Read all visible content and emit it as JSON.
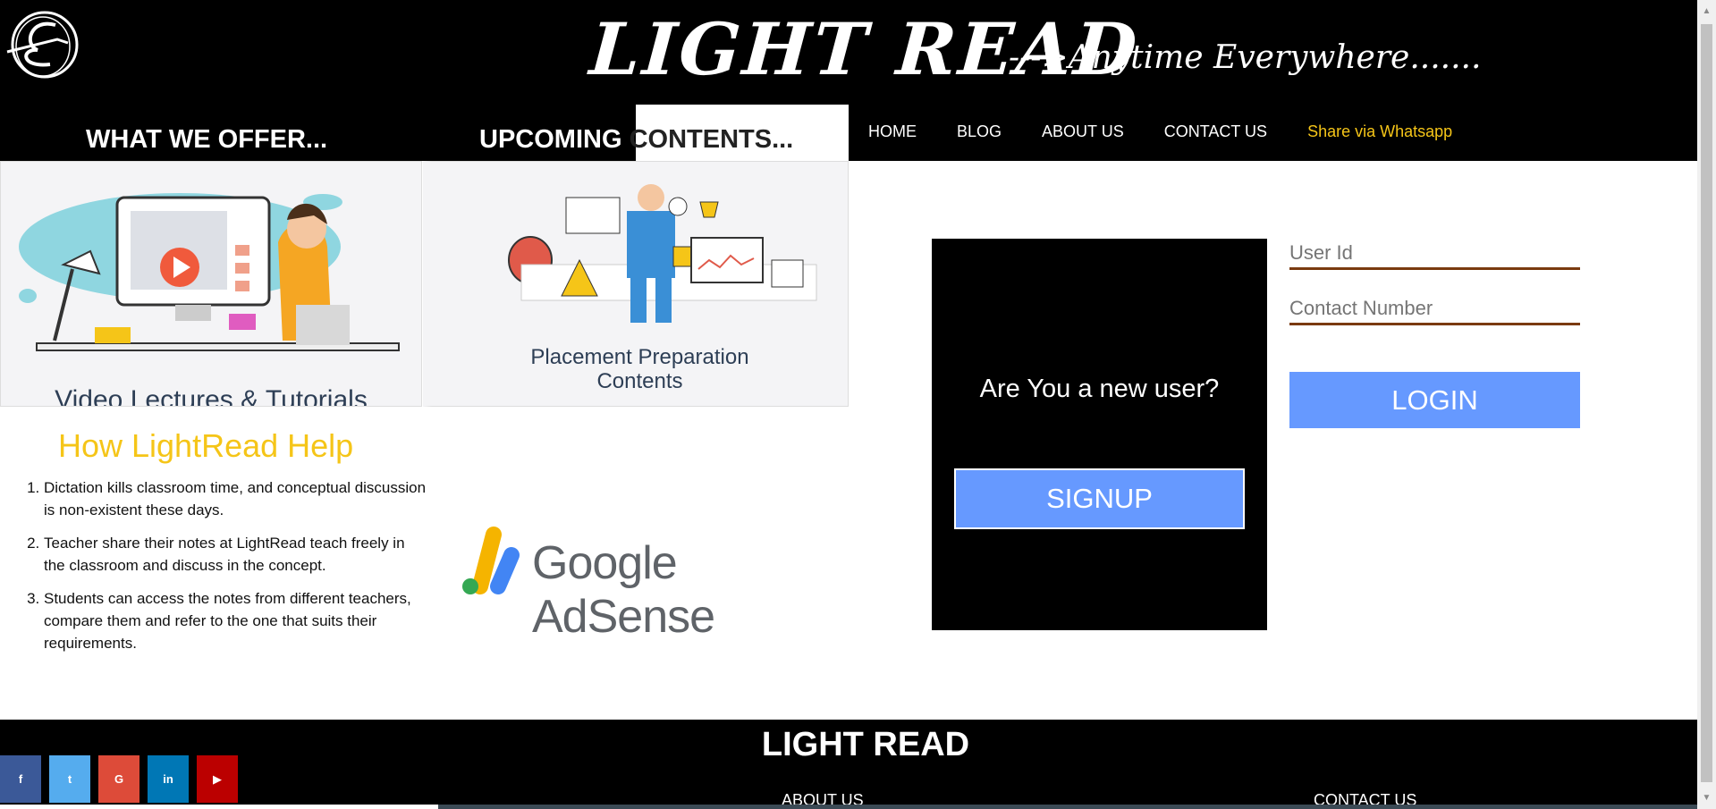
{
  "header": {
    "site_title": "LIGHT READ",
    "tagline": "--->Anytime Everywhere.......",
    "offer_heading": "WHAT WE OFFER...",
    "upcoming_heading_part1": "UPCOMING ",
    "upcoming_heading_part2": "CONTENTS..."
  },
  "nav": {
    "items": [
      {
        "label": "HOME"
      },
      {
        "label": "BLOG"
      },
      {
        "label": "ABOUT US"
      },
      {
        "label": "CONTACT US"
      },
      {
        "label": "Share via Whatsapp"
      }
    ]
  },
  "cards": {
    "video_caption": "Video Lectures & Tutorials",
    "placement_caption_line1": "Placement Preparation",
    "placement_caption_line2": "Contents"
  },
  "help": {
    "title": "How LightRead Help",
    "items": [
      "Dictation kills classroom time, and conceptual discussion is non-existent these days.",
      "Teacher share their notes at LightRead teach freely in the classroom and discuss in the concept.",
      "Students can access the notes from different teachers, compare them and refer to the one that suits their requirements."
    ]
  },
  "adsense": {
    "label": "Google AdSense"
  },
  "signup": {
    "question": "Are You a new user?",
    "button_label": "SIGNUP"
  },
  "login": {
    "userid_placeholder": "User Id",
    "contact_placeholder": "Contact Number",
    "button_label": "LOGIN"
  },
  "footer": {
    "title": "LIGHT READ",
    "about_label": "ABOUT US",
    "contact_label": "CONTACT US"
  },
  "social": [
    {
      "icon": "facebook-icon",
      "glyph": "f",
      "color": "#3b5998"
    },
    {
      "icon": "twitter-icon",
      "glyph": "t",
      "color": "#55acee"
    },
    {
      "icon": "google-plus-icon",
      "glyph": "G",
      "color": "#dd4b39"
    },
    {
      "icon": "linkedin-icon",
      "glyph": "in",
      "color": "#0077b5"
    },
    {
      "icon": "youtube-icon",
      "glyph": "▶",
      "color": "#bb0000"
    }
  ],
  "colors": {
    "accent_yellow": "#f5c518",
    "button_blue": "#6699ff",
    "input_underline": "#7a3a10"
  }
}
